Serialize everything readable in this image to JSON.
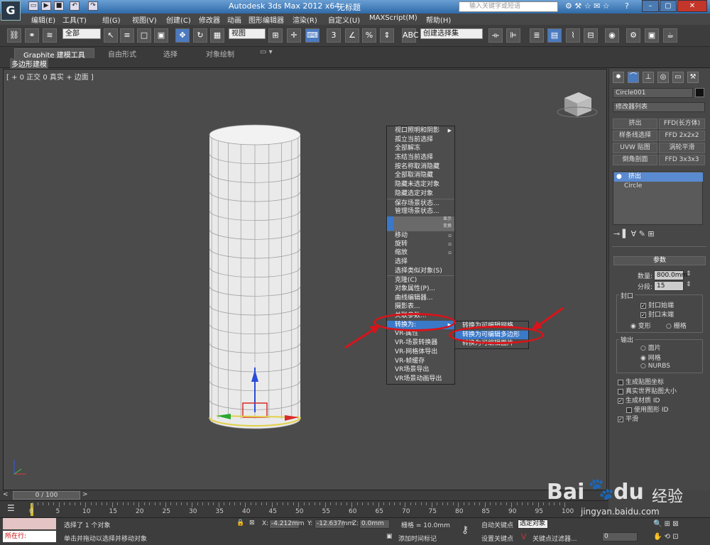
{
  "window": {
    "app_title": "Autodesk 3ds Max  2012 x64",
    "file_title": "无标题",
    "search_placeholder": "输入关键字或短语",
    "min_label": "–",
    "max_label": "▢",
    "close_label": "✕"
  },
  "menu": [
    "编辑(E)",
    "工具(T)",
    "组(G)",
    "视图(V)",
    "创建(C)",
    "修改器",
    "动画",
    "图形编辑器",
    "渲染(R)",
    "自定义(U)",
    "MAXScript(M)",
    "帮助(H)"
  ],
  "toolbar": {
    "selection_filter": "全部",
    "ref_coord": "视图",
    "named_selection": "创建选择集"
  },
  "ribbon": {
    "tabs": [
      "Graphite 建模工具",
      "自由形式",
      "选择",
      "对象绘制"
    ],
    "subtab": "多边形建模"
  },
  "viewport": {
    "label": "[ + 0 正交 0 真实 + 边面 ]",
    "gizmo_axis": "z"
  },
  "context_menu": {
    "items": [
      "视口照明和阴影",
      "孤立当前选择",
      "全部解冻",
      "冻结当前选择",
      "按名称取消隐藏",
      "全部取消隐藏",
      "隐藏未选定对象",
      "隐藏选定对象",
      "保存场景状态...",
      "管理场景状态...",
      "",
      "",
      "移动",
      "旋转",
      "缩放",
      "选择",
      "选择类似对象(S)",
      "克隆(C)",
      "对象属性(P)...",
      "曲线编辑器...",
      "摄影表...",
      "关联参数...",
      "转换为:",
      "VR-属性",
      "VR-场景转换器",
      "VR-网格体导出",
      "VR-帧缓存",
      "VR场景导出",
      "VR场景动画导出"
    ],
    "section_labels": [
      "显示",
      "变换"
    ],
    "submenu": [
      "转换为可编辑网格",
      "转换为可编辑多边形",
      "转换为可编辑面片"
    ]
  },
  "command_panel": {
    "object_name": "Circle001",
    "modifier_list": "修改器列表",
    "buttons": [
      "挤出",
      "FFD(长方体)",
      "样条线选择",
      "FFD 2x2x2",
      "UVW 贴图",
      "涡轮平滑",
      "倒角剖面",
      "FFD 3x3x3"
    ],
    "stack": [
      "挤出",
      "Circle"
    ],
    "params_title": "参数",
    "amount_label": "数量:",
    "amount_value": "800.0mm",
    "segments_label": "分段:",
    "segments_value": "15",
    "capping_label": "封口",
    "cap_start": "封口始端",
    "cap_end": "封口末端",
    "morph": "变形",
    "grid": "栅格",
    "output_label": "输出",
    "patch": "面片",
    "mesh": "网格",
    "nurbs": "NURBS",
    "gen_map": "生成贴图坐标",
    "real_world": "真实世界贴图大小",
    "gen_mat": "生成材质 ID",
    "use_shape": "使用图形 ID",
    "smooth": "平滑"
  },
  "timeline": {
    "frame": "0 / 100",
    "ticks": [
      "0",
      "5",
      "10",
      "15",
      "20",
      "25",
      "30",
      "35",
      "40",
      "45",
      "50",
      "55",
      "60",
      "65",
      "70",
      "75",
      "80",
      "85",
      "90",
      "95",
      "100"
    ]
  },
  "status": {
    "selection_info": "选择了 1 个对象",
    "prompt": "单击并拖动以选择并移动对象",
    "running": "所在行:",
    "x_label": "X:",
    "x_value": "-4.212mm",
    "y_label": "Y:",
    "y_value": "-12.637mm",
    "z_label": "Z:",
    "z_value": "0.0mm",
    "grid": "栅格 = 10.0mm",
    "add_time_tag": "添加时间标记",
    "auto_key": "自动关键点",
    "selected": "选定对象",
    "set_key": "设置关键点",
    "key_filters": "关键点过滤器...",
    "frame_field": "0"
  },
  "watermark": {
    "brand": "Bai",
    "brand2": "du",
    "cn": "经验",
    "url": "jingyan.baidu.com"
  }
}
